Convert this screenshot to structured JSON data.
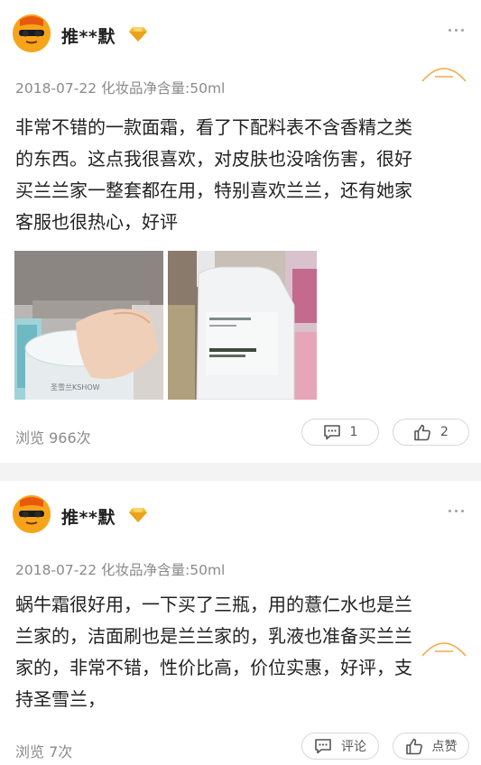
{
  "reviews": [
    {
      "username": "推**默",
      "meta": "2018-07-22 化妆品净含量:50ml",
      "content": "非常不错的一款面霜，看了下配料表不含香精之类\n的东西。这点我很喜欢，对皮肤也没啥伤害，很好\n买兰兰家一整套都在用，特别喜欢兰兰，还有她家\n客服也很热心，好评",
      "photos": [
        {
          "name": "cream-jar-photo",
          "jar_label": "圣雪兰KSHOW"
        },
        {
          "name": "toner-bottle-photo"
        }
      ],
      "views": "浏览 966次",
      "comment_count": "1",
      "like_count": "2"
    },
    {
      "username": "推**默",
      "meta": "2018-07-22 化妆品净含量:50ml",
      "content": "蜗牛霜很好用，一下买了三瓶，用的薏仁水也是兰\n兰家的，洁面刷也是兰兰家的，乳液也准备买兰兰\n家的，非常不错，性价比高，价位实惠，好评，支\n持圣雪兰，",
      "views": "浏览 7次",
      "comment_label": "评论",
      "like_label": "点赞"
    }
  ],
  "colors": {
    "avatar_bg": "#f6a51a",
    "vip_gold": "#f5b82e",
    "stamp_orange": "#f3a94a",
    "divider": "#f3f3f3"
  },
  "icons": {
    "avatar": "sunglasses-face-icon",
    "vip": "diamond-icon",
    "more": "more-dots-icon",
    "stamp": "stamp-icon",
    "comment": "comment-bubble-icon",
    "like": "thumbs-up-icon"
  }
}
